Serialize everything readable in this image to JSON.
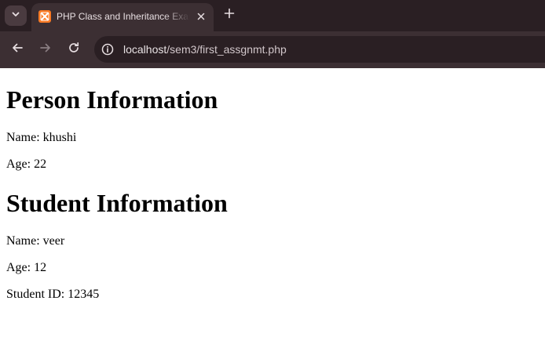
{
  "browser": {
    "tab": {
      "title": "PHP Class and Inheritance Example",
      "favicon": "xampp-icon"
    },
    "url": {
      "host": "localhost",
      "path": "/sem3/first_assgnmt.php"
    },
    "colors": {
      "tabstrip": "#2a1f23",
      "toolbar": "#3c2f33",
      "favicon": "#fb7a24"
    }
  },
  "content": {
    "person": {
      "heading": "Person Information",
      "name": "Name: khushi",
      "age": "Age: 22"
    },
    "student": {
      "heading": "Student Information",
      "name": "Name: veer",
      "age": "Age: 12",
      "student_id": "Student ID: 12345"
    }
  }
}
